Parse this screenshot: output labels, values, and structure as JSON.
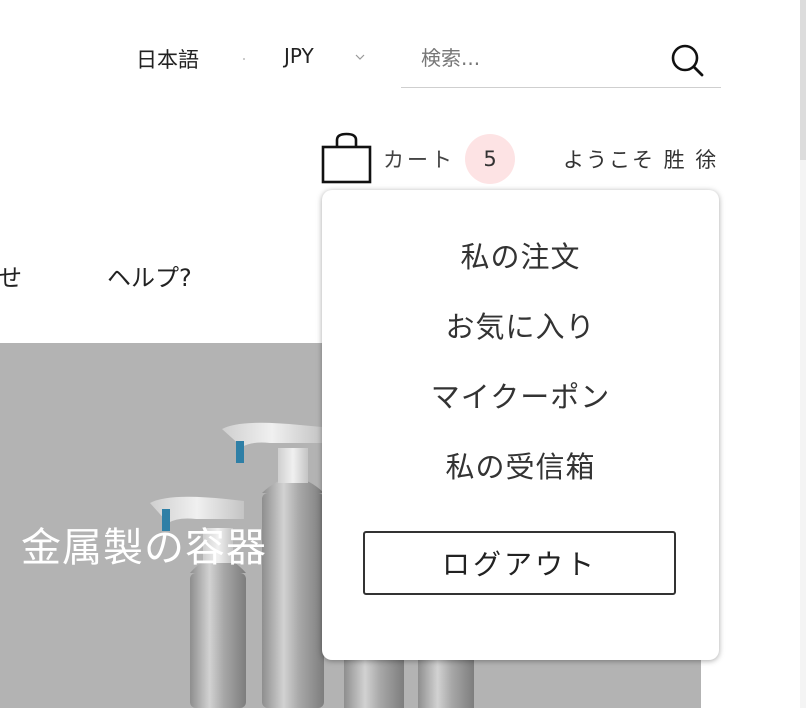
{
  "header": {
    "language": "日本語",
    "currency": "JPY",
    "search": {
      "placeholder": "検索..."
    }
  },
  "cart": {
    "label": "カート",
    "count": "5",
    "badge_color": "#fde3e4"
  },
  "user": {
    "welcome": "ようこそ 胜 徐"
  },
  "nav": {
    "items": [
      {
        "label": "せ"
      },
      {
        "label": "ヘルプ?"
      }
    ]
  },
  "hero": {
    "title": "金属製の容器",
    "background_color": "#b3b3b3"
  },
  "dropdown": {
    "items": [
      {
        "label": "私の注文"
      },
      {
        "label": "お気に入り"
      },
      {
        "label": "マイクーポン"
      },
      {
        "label": "私の受信箱"
      }
    ],
    "logout_label": "ログアウト"
  },
  "icons": {
    "search": "search-icon",
    "cart": "shopping-bag-icon",
    "currency_dropdown": "chevron-down-icon"
  }
}
